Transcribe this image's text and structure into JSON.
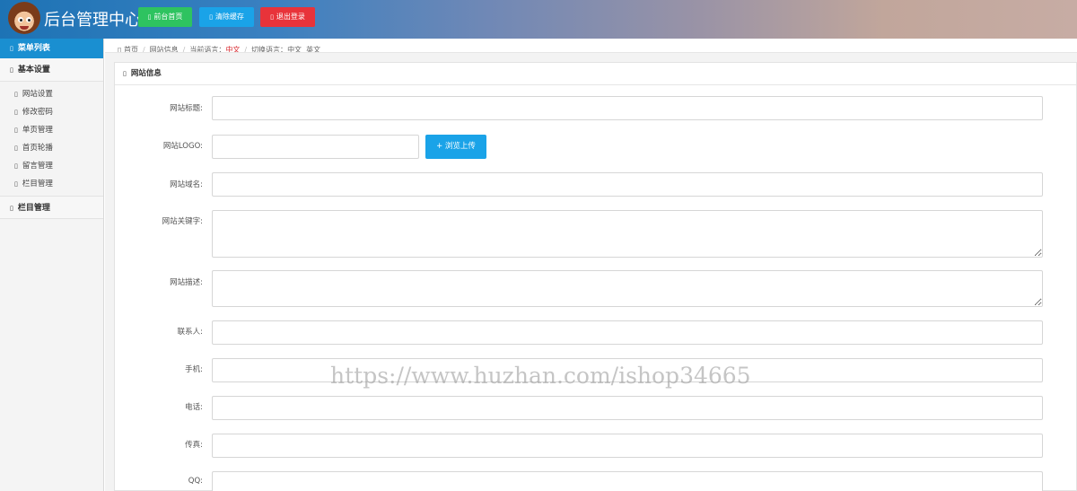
{
  "header": {
    "title": "后台管理中心",
    "buttons": [
      {
        "label": "前台首页",
        "icon": "home-icon",
        "color": "#2ec360"
      },
      {
        "label": "清除缓存",
        "icon": "refresh-icon",
        "color": "#1aa3e8"
      },
      {
        "label": "退出登录",
        "icon": "power-icon",
        "color": "#e8333a"
      }
    ]
  },
  "sidebar": {
    "head": "菜单列表",
    "groups": [
      {
        "label": "基本设置",
        "items": [
          "网站设置",
          "修改密码",
          "单页管理",
          "首页轮播",
          "留言管理",
          "栏目管理"
        ]
      },
      {
        "label": "栏目管理",
        "items": []
      }
    ]
  },
  "breadcrumb": {
    "home": "首页",
    "current": "网站信息",
    "current_lang_label": "当前语言：",
    "current_lang": "中文",
    "switch_lang_label": "切换语言：",
    "langs": [
      "中文",
      "英文"
    ]
  },
  "panel": {
    "title": "网站信息",
    "upload_label": "+ 浏览上传",
    "fields": [
      {
        "label": "网站标题:",
        "value": ""
      },
      {
        "label": "网站LOGO:",
        "value": ""
      },
      {
        "label": "网站域名:",
        "value": ""
      },
      {
        "label": "网站关键字:",
        "value": ""
      },
      {
        "label": "网站描述:",
        "value": ""
      },
      {
        "label": "联系人:",
        "value": ""
      },
      {
        "label": "手机:",
        "value": ""
      },
      {
        "label": "电话:",
        "value": ""
      },
      {
        "label": "传真:",
        "value": ""
      },
      {
        "label": "QQ:",
        "value": ""
      }
    ]
  },
  "watermark": "https://www.huzhan.com/ishop34665"
}
